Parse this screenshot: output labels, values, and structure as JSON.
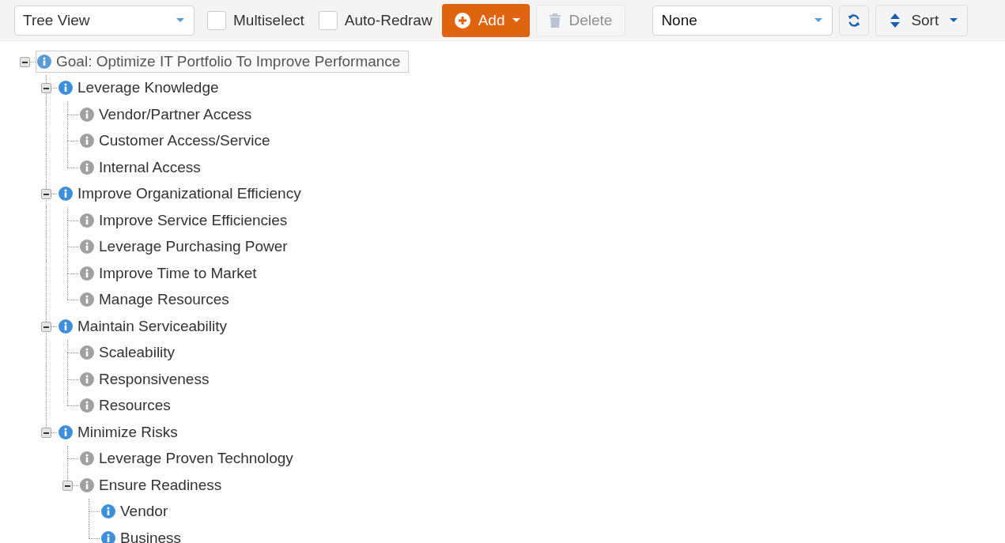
{
  "toolbar": {
    "view_select": {
      "value": "Tree View"
    },
    "checkboxes": [
      {
        "label": "Multiselect",
        "checked": false
      },
      {
        "label": "Auto-Redraw",
        "checked": false
      }
    ],
    "add_button": {
      "label": "Add"
    },
    "delete_button": {
      "label": "Delete",
      "disabled": true
    },
    "filter_select": {
      "value": "None"
    },
    "sort_button": {
      "label": "Sort"
    }
  },
  "tree": [
    {
      "label": "Goal: Optimize IT Portfolio To Improve Performance",
      "color": "#5b9bd5",
      "selected": true,
      "expanded": true,
      "children": [
        {
          "label": "Leverage Knowledge",
          "color": "#3d8fd9",
          "selected": false,
          "expanded": true,
          "children": [
            {
              "label": "Vendor/Partner Access",
              "color": "#a0a0a0",
              "selected": false
            },
            {
              "label": "Customer Access/Service",
              "color": "#a0a0a0",
              "selected": false
            },
            {
              "label": "Internal Access",
              "color": "#a0a0a0",
              "selected": false
            }
          ]
        },
        {
          "label": "Improve Organizational Efficiency",
          "color": "#3d8fd9",
          "selected": false,
          "expanded": true,
          "children": [
            {
              "label": "Improve Service Efficiencies",
              "color": "#a0a0a0",
              "selected": false
            },
            {
              "label": "Leverage Purchasing Power",
              "color": "#a0a0a0",
              "selected": false
            },
            {
              "label": "Improve Time to Market",
              "color": "#a0a0a0",
              "selected": false
            },
            {
              "label": "Manage Resources",
              "color": "#a0a0a0",
              "selected": false
            }
          ]
        },
        {
          "label": "Maintain Serviceability",
          "color": "#3d8fd9",
          "selected": false,
          "expanded": true,
          "children": [
            {
              "label": "Scaleability",
              "color": "#a0a0a0",
              "selected": false
            },
            {
              "label": "Responsiveness",
              "color": "#a0a0a0",
              "selected": false
            },
            {
              "label": "Resources",
              "color": "#a0a0a0",
              "selected": false
            }
          ]
        },
        {
          "label": "Minimize Risks",
          "color": "#3d8fd9",
          "selected": false,
          "expanded": true,
          "children": [
            {
              "label": "Leverage Proven Technology",
              "color": "#a0a0a0",
              "selected": false
            },
            {
              "label": "Ensure Readiness",
              "color": "#a0a0a0",
              "selected": false,
              "expanded": true,
              "children": [
                {
                  "label": "Vendor",
                  "color": "#3d8fd9",
                  "selected": false
                },
                {
                  "label": "Business",
                  "color": "#3d8fd9",
                  "selected": false
                }
              ]
            }
          ]
        }
      ]
    }
  ]
}
